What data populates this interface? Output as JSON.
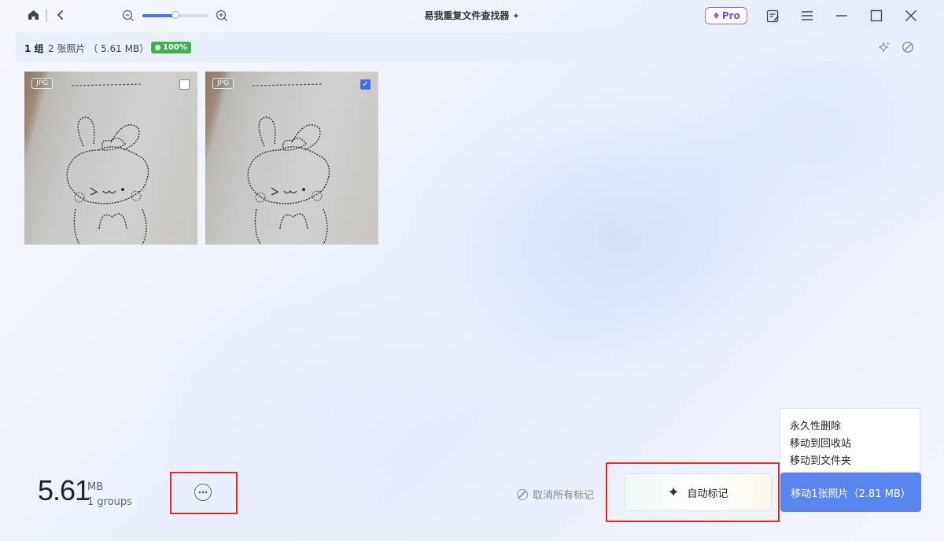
{
  "app": {
    "title": "易我重复文件查找器",
    "pro_label": "Pro"
  },
  "zoom": {
    "level": 0.5
  },
  "group": {
    "title": "1 组",
    "info": "2 张照片 （ 5.61 MB）",
    "similarity": "100%"
  },
  "photos": [
    {
      "type": "JPG",
      "checked": false
    },
    {
      "type": "JPG",
      "checked": true
    }
  ],
  "summary": {
    "size": "5.61",
    "unit": "MB",
    "groups": "1 groups"
  },
  "actions": {
    "clear_marks": "取消所有标记",
    "auto_mark": "自动标记",
    "move_button": "移动1张照片（2.81 MB）",
    "menu": [
      "永久性删除",
      "移动到回收站",
      "移动到文件夹"
    ]
  },
  "colors": {
    "accent": "#5a85ee",
    "checkbox": "#3d6ef0",
    "badge_green": "#3cb34a",
    "pro": "#9b6be6",
    "highlight": "#e8262b"
  }
}
